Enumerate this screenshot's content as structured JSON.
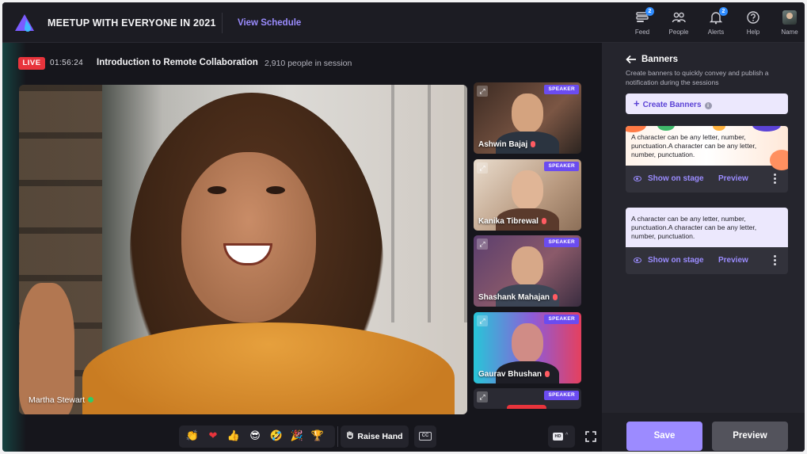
{
  "app": {
    "title": "MEETUP WITH EVERYONE IN 2021",
    "view_schedule": "View Schedule",
    "brand_color": "#7b5cff"
  },
  "nav": [
    {
      "id": "feed",
      "label": "Feed",
      "icon": "feed-icon",
      "badge": "2"
    },
    {
      "id": "people",
      "label": "People",
      "icon": "people-icon",
      "badge": ""
    },
    {
      "id": "alerts",
      "label": "Alerts",
      "icon": "bell-icon",
      "badge": "2"
    },
    {
      "id": "help",
      "label": "Help",
      "icon": "help-icon",
      "badge": ""
    },
    {
      "id": "name",
      "label": "Name",
      "icon": "avatar",
      "badge": ""
    }
  ],
  "session": {
    "live_label": "LIVE",
    "timer": "01:56:24",
    "title": "Introduction to Remote Collaboration",
    "attendees": "2,910 people in session"
  },
  "stage": {
    "main_speaker": "Martha Stewart"
  },
  "speakers": [
    {
      "name": "Ashwin Bajaj",
      "tag": "SPEAKER"
    },
    {
      "name": "Kanika Tibrewal",
      "tag": "SPEAKER"
    },
    {
      "name": "Shashank Mahajan",
      "tag": "SPEAKER"
    },
    {
      "name": "Gaurav Bhushan",
      "tag": "SPEAKER"
    },
    {
      "name": "",
      "tag": "SPEAKER"
    }
  ],
  "controls": {
    "reactions": [
      "👏",
      "❤",
      "👍",
      "😎",
      "🤣",
      "🎉",
      "🏆"
    ],
    "raise_hand": "Raise Hand",
    "cc": "CC",
    "hd": "HD"
  },
  "panel": {
    "title": "Banners",
    "description": "Create banners to quickly convey and publish a notification during the sessions",
    "create_label": "Create Banners",
    "banners": [
      {
        "text": "A character can be any letter, number, punctuation.A character can be any letter, number, punctuation.",
        "show_label": "Show on stage",
        "preview_label": "Preview"
      },
      {
        "text": "A character can be any letter, number, punctuation.A character can be any letter, number, punctuation.",
        "show_label": "Show on stage",
        "preview_label": "Preview"
      }
    ],
    "save_label": "Save",
    "preview_label": "Preview"
  }
}
